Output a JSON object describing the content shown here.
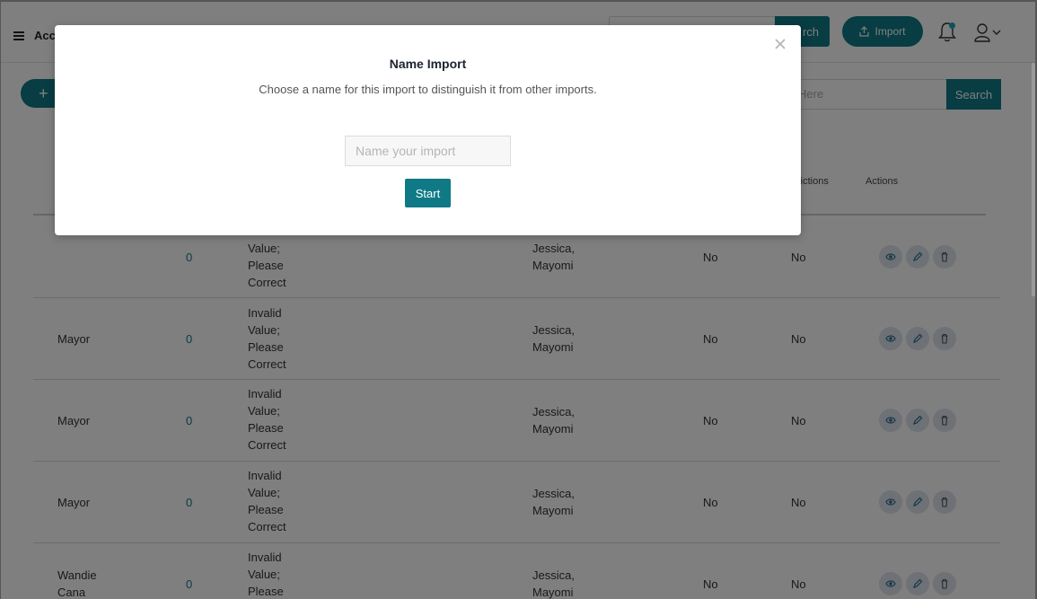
{
  "header": {
    "brand": "Acco",
    "search_button": "rch",
    "import_button": "Import"
  },
  "toolbar": {
    "add_label": "+",
    "filter_placeholder": "Here",
    "filter_button": "Search"
  },
  "table": {
    "headers": {
      "restrictions": "rictions",
      "actions": "Actions"
    },
    "rows": [
      {
        "name": "",
        "count": "0",
        "error": [
          "Value;",
          "Please",
          "Correct"
        ],
        "owner": [
          "Jessica,",
          "Mayomi"
        ],
        "flag1": "No",
        "flag2": "No"
      },
      {
        "name": "Mayor",
        "count": "0",
        "error": [
          "Invalid",
          "Value;",
          "Please",
          "Correct"
        ],
        "owner": [
          "Jessica,",
          "Mayomi"
        ],
        "flag1": "No",
        "flag2": "No"
      },
      {
        "name": "Mayor",
        "count": "0",
        "error": [
          "Invalid",
          "Value;",
          "Please",
          "Correct"
        ],
        "owner": [
          "Jessica,",
          "Mayomi"
        ],
        "flag1": "No",
        "flag2": "No"
      },
      {
        "name": "Mayor",
        "count": "0",
        "error": [
          "Invalid",
          "Value;",
          "Please",
          "Correct"
        ],
        "owner": [
          "Jessica,",
          "Mayomi"
        ],
        "flag1": "No",
        "flag2": "No"
      },
      {
        "name": [
          "Wandie",
          "Cana"
        ],
        "count": "0",
        "error": [
          "Invalid",
          "Value;",
          "Please"
        ],
        "owner": [
          "Jessica,",
          "Mayomi"
        ],
        "flag1": "No",
        "flag2": "No"
      }
    ]
  },
  "modal": {
    "title": "Name Import",
    "subtitle": "Choose a name for this import to distinguish it from other imports.",
    "input_placeholder": "Name your import",
    "start_button": "Start"
  },
  "colors": {
    "accent": "#0f7a86",
    "overlay": "rgba(0,0,0,0.5)"
  },
  "icons": [
    "menu-icon",
    "bell-icon",
    "user-icon",
    "chevron-down-icon",
    "upload-icon",
    "eye-icon",
    "pencil-icon",
    "trash-icon",
    "close-icon"
  ]
}
